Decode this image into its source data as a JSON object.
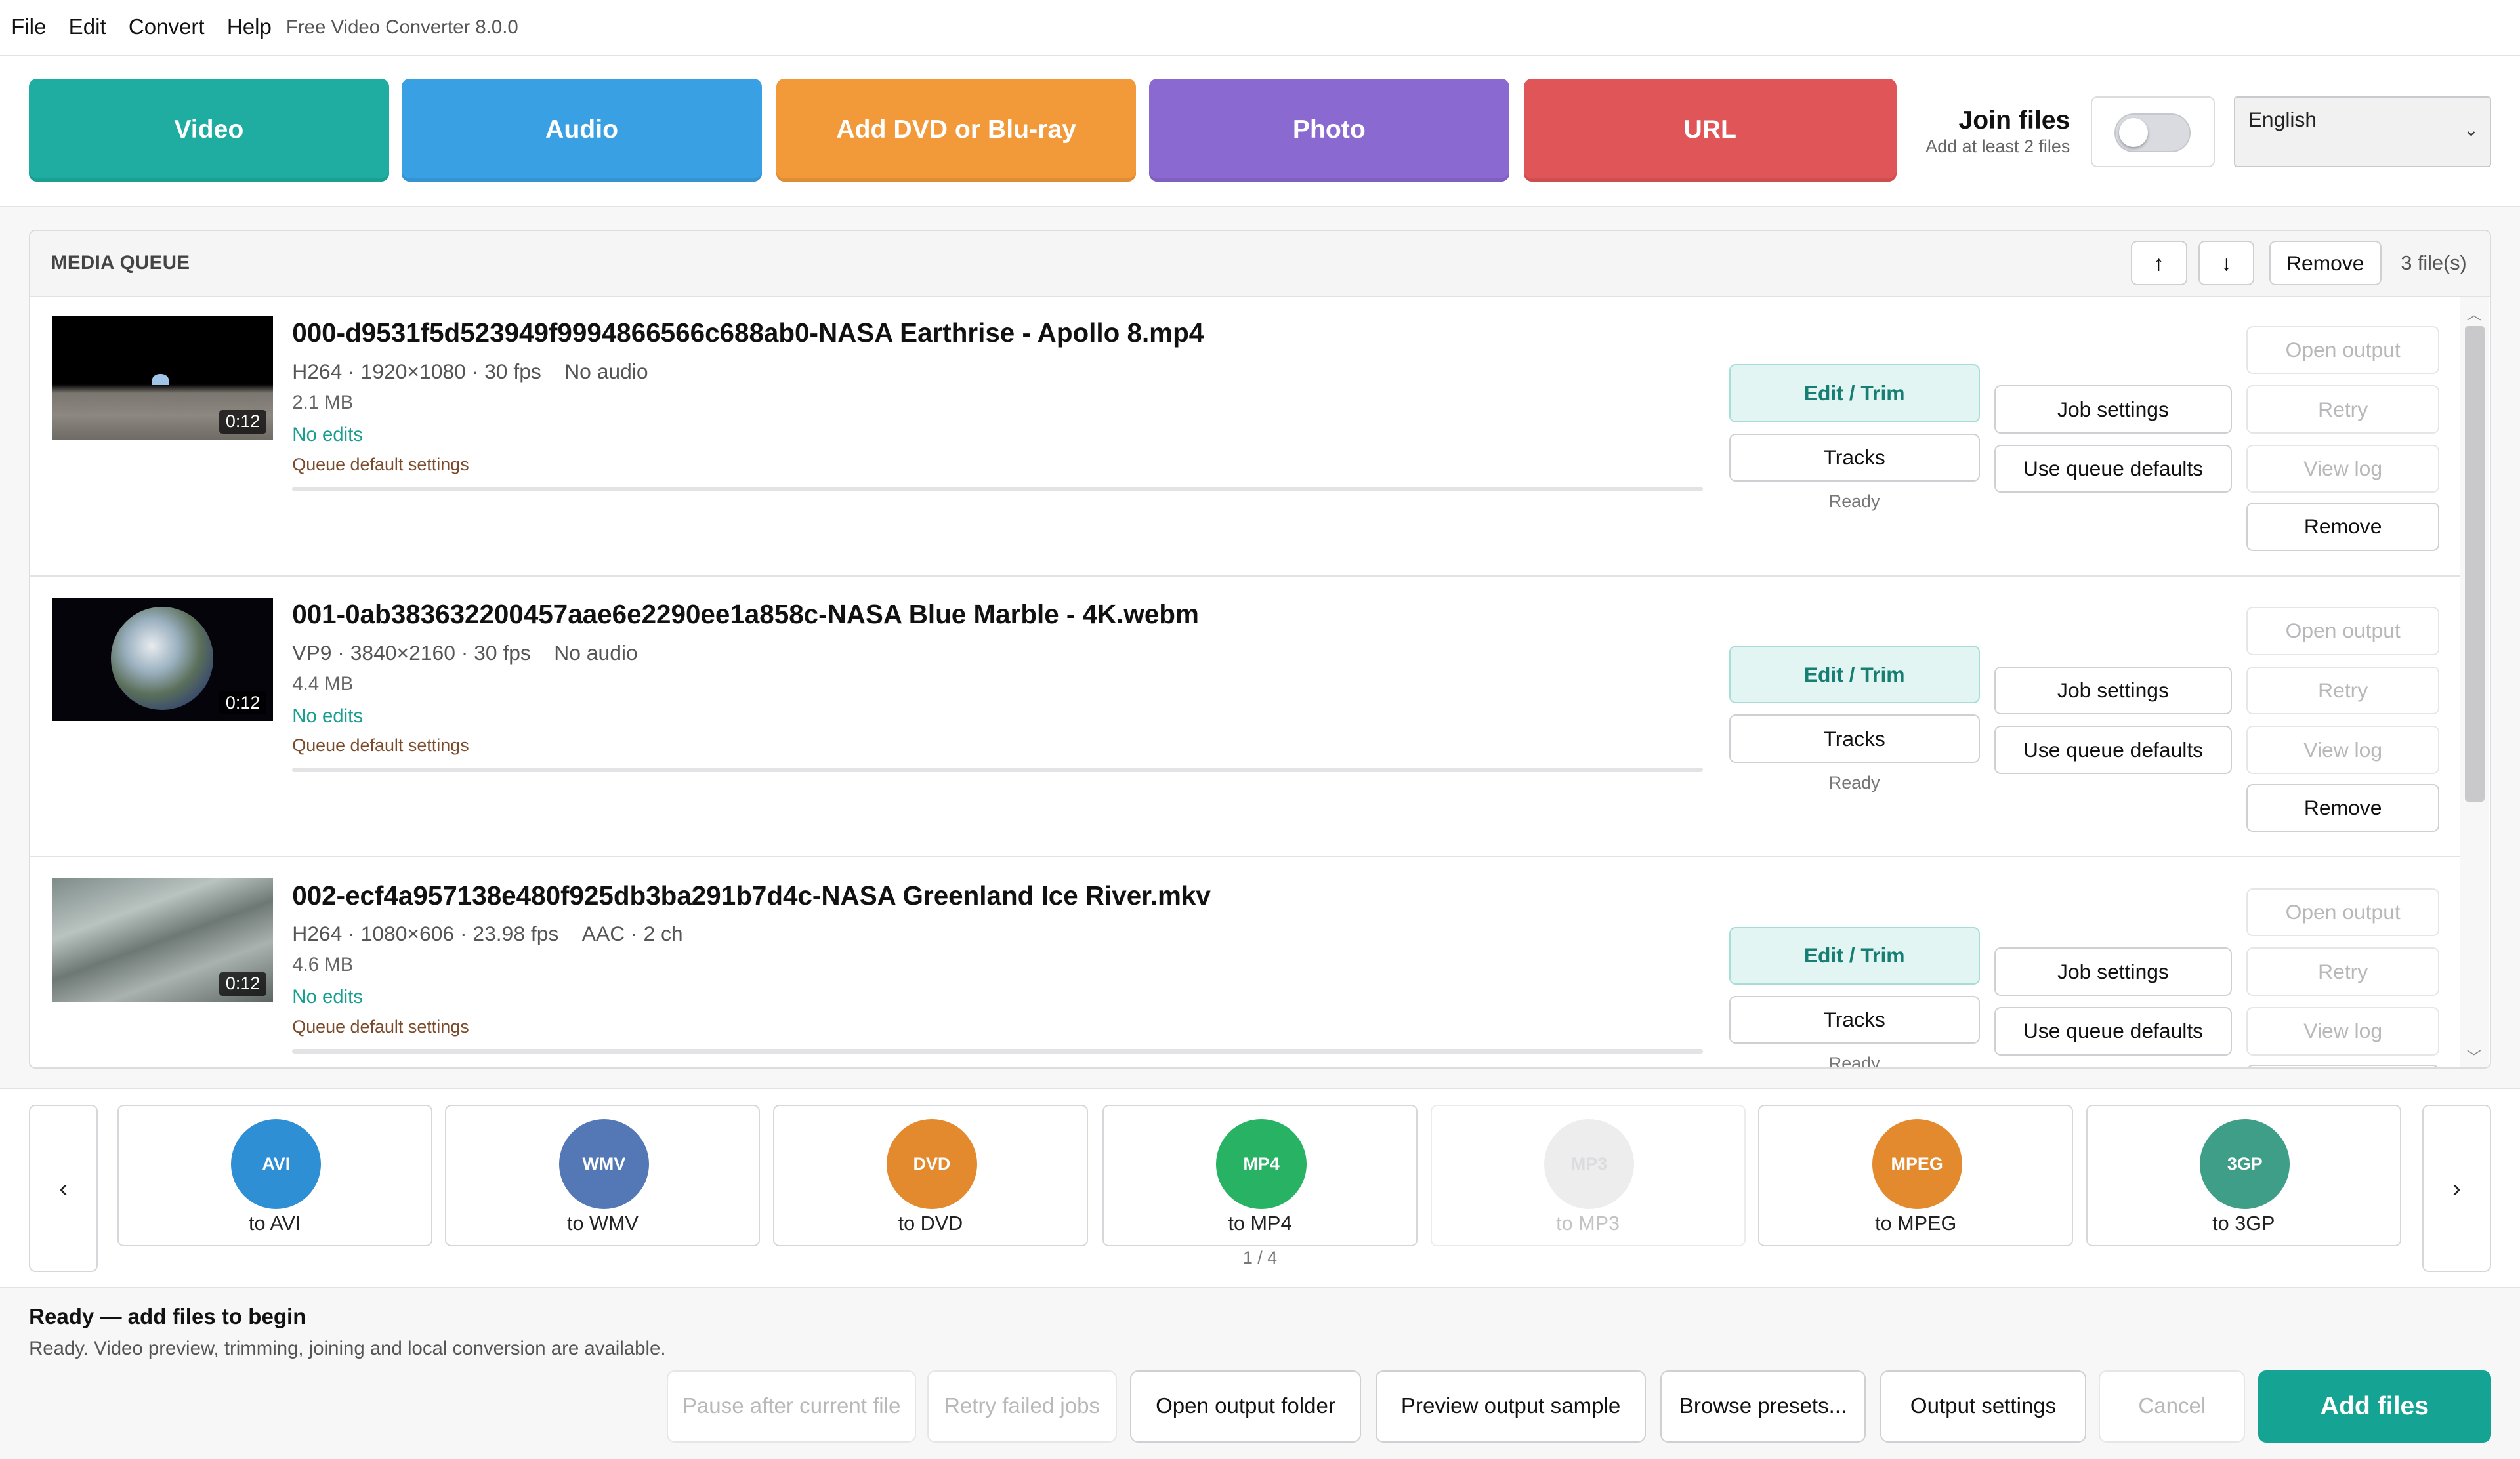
{
  "menu": {
    "file": "File",
    "edit": "Edit",
    "convert": "Convert",
    "help": "Help",
    "app_title": "Free Video Converter 8.0.0"
  },
  "toolbar": {
    "video": "Video",
    "audio": "Audio",
    "dvd": "Add DVD or Blu-ray",
    "photo": "Photo",
    "url": "URL",
    "join_title": "Join files",
    "join_sub": "Add at least 2 files",
    "language": "English"
  },
  "colors": {
    "video": "#1eada0",
    "audio": "#3aa0e4",
    "dvd": "#f2993a",
    "photo": "#8a69d1",
    "url": "#e05557",
    "primary": "#15a394"
  },
  "queue": {
    "title": "MEDIA QUEUE",
    "up": "↑",
    "down": "↓",
    "remove": "Remove",
    "count": "3 file(s)",
    "items": [
      {
        "name": "000-d9531f5d523949f9994866566c688ab0-NASA Earthrise - Apollo 8.mp4",
        "video": "H264 · 1920×1080 · 30 fps",
        "audio": "No audio",
        "size": "2.1 MB",
        "edits": "No edits",
        "settings": "Queue default settings",
        "duration": "0:12",
        "status": "Ready"
      },
      {
        "name": "001-0ab383632200457aae6e2290ee1a858c-NASA Blue Marble - 4K.webm",
        "video": "VP9 · 3840×2160 · 30 fps",
        "audio": "No audio",
        "size": "4.4 MB",
        "edits": "No edits",
        "settings": "Queue default settings",
        "duration": "0:12",
        "status": "Ready"
      },
      {
        "name": "002-ecf4a957138e480f925db3ba291b7d4c-NASA Greenland Ice River.mkv",
        "video": "H264 · 1080×606 · 23.98 fps",
        "audio": "AAC · 2 ch",
        "size": "4.6 MB",
        "edits": "No edits",
        "settings": "Queue default settings",
        "duration": "0:12",
        "status": "Ready"
      }
    ],
    "actions": {
      "edit_trim": "Edit / Trim",
      "tracks": "Tracks",
      "job_settings": "Job settings",
      "use_defaults": "Use queue defaults",
      "open_output": "Open output",
      "retry": "Retry",
      "view_log": "View log",
      "remove": "Remove"
    }
  },
  "formats": {
    "prev": "‹",
    "next": "›",
    "pager": "1 / 4",
    "items": [
      {
        "badge": "AVI",
        "label": "to AVI",
        "color": "#2f8fd5"
      },
      {
        "badge": "WMV",
        "label": "to WMV",
        "color": "#5378b5"
      },
      {
        "badge": "DVD",
        "label": "to DVD",
        "color": "#e38a2e"
      },
      {
        "badge": "MP4",
        "label": "to MP4",
        "color": "#27b363"
      },
      {
        "badge": "MP3",
        "label": "to MP3",
        "color": "#e0e0e2"
      },
      {
        "badge": "MPEG",
        "label": "to MPEG",
        "color": "#e38a2e"
      },
      {
        "badge": "3GP",
        "label": "to 3GP",
        "color": "#3f9e87"
      }
    ]
  },
  "status": {
    "heading": "Ready — add files to begin",
    "detail": "Ready. Video preview, trimming, joining and local conversion are available."
  },
  "bottom": {
    "pause": "Pause after current file",
    "retry_failed": "Retry failed jobs",
    "open_folder": "Open output folder",
    "preview": "Preview output sample",
    "presets": "Browse presets...",
    "output_settings": "Output settings",
    "cancel": "Cancel",
    "add_files": "Add files"
  }
}
